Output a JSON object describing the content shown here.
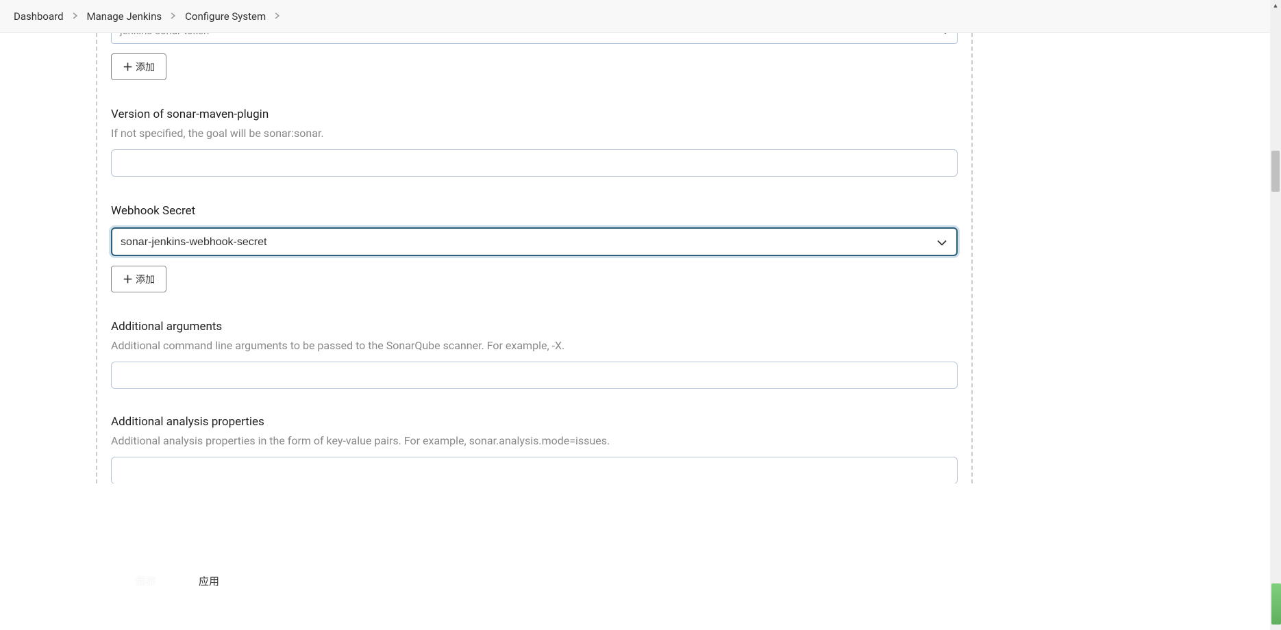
{
  "breadcrumb": {
    "items": [
      {
        "label": "Dashboard"
      },
      {
        "label": "Manage Jenkins"
      },
      {
        "label": "Configure System"
      }
    ]
  },
  "topSelect": {
    "value": "jenkins-sonar-token"
  },
  "addButton": {
    "label": "添加"
  },
  "fields": {
    "version": {
      "label": "Version of sonar-maven-plugin",
      "help": "If not specified, the goal will be sonar:sonar.",
      "value": ""
    },
    "webhookSecret": {
      "label": "Webhook Secret",
      "value": "sonar-jenkins-webhook-secret"
    },
    "additionalArgs": {
      "label": "Additional arguments",
      "help": "Additional command line arguments to be passed to the SonarQube scanner. For example, -X.",
      "value": ""
    },
    "additionalProps": {
      "label": "Additional analysis properties",
      "help": "Additional analysis properties in the form of key-value pairs. For example, sonar.analysis.mode=issues.",
      "value": ""
    }
  },
  "actions": {
    "save": "保存",
    "apply": "应用"
  }
}
